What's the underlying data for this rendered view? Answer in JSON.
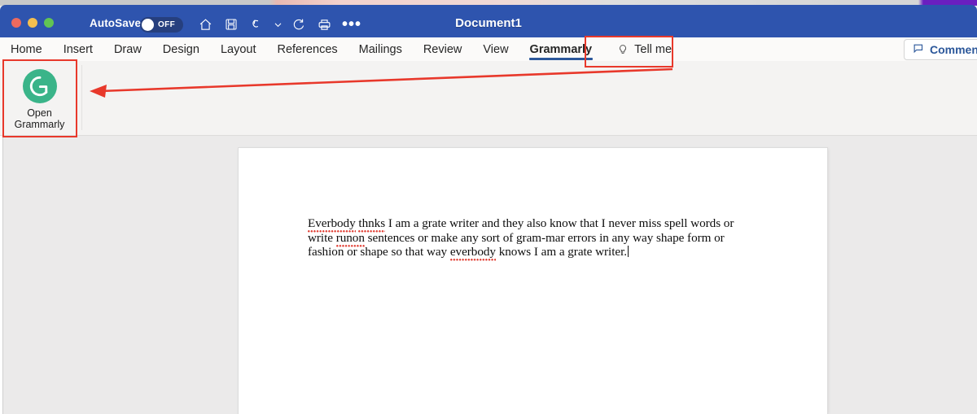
{
  "window": {
    "title": "Document1",
    "traffic_lights": [
      "close",
      "minimize",
      "maximize"
    ],
    "accent_blue": "#2e54ae",
    "annotation_red": "#e8382b"
  },
  "quick_access": {
    "autosave_label": "AutoSave",
    "autosave_state": "OFF",
    "icons": [
      {
        "name": "home-icon",
        "label": "Home"
      },
      {
        "name": "save-icon",
        "label": "Save"
      },
      {
        "name": "undo-icon",
        "label": "Undo"
      },
      {
        "name": "chevron-down-icon",
        "label": "More undo options"
      },
      {
        "name": "redo-icon",
        "label": "Redo"
      },
      {
        "name": "print-icon",
        "label": "Print"
      },
      {
        "name": "more-options-icon",
        "label": "…"
      }
    ]
  },
  "ribbon": {
    "tabs": [
      {
        "label": "Home",
        "active": false
      },
      {
        "label": "Insert",
        "active": false
      },
      {
        "label": "Draw",
        "active": false
      },
      {
        "label": "Design",
        "active": false
      },
      {
        "label": "Layout",
        "active": false
      },
      {
        "label": "References",
        "active": false
      },
      {
        "label": "Mailings",
        "active": false
      },
      {
        "label": "Review",
        "active": false
      },
      {
        "label": "View",
        "active": false
      },
      {
        "label": "Grammarly",
        "active": true
      }
    ],
    "tell_me": "Tell me",
    "comments_button": "Comments",
    "grammarly_group": {
      "button_line1": "Open",
      "button_line2": "Grammarly",
      "logo_name": "grammarly-logo",
      "logo_color": "#3ab489"
    }
  },
  "document": {
    "paragraph_segments": [
      {
        "text": "Everbody",
        "misspelled": true
      },
      {
        "text": " ",
        "misspelled": false
      },
      {
        "text": "thnks",
        "misspelled": true
      },
      {
        "text": " I am a grate writer and they also know that I never miss spell words or write ",
        "misspelled": false
      },
      {
        "text": "runon",
        "misspelled": true
      },
      {
        "text": " sentences or make any sort of gram-mar errors in any way shape form or fashion or shape so that way ",
        "misspelled": false
      },
      {
        "text": "everbody",
        "misspelled": true
      },
      {
        "text": " knows I am a grate writer.",
        "misspelled": false
      }
    ],
    "full_text": "Everbody thnks I am a grate writer and they also know that I never miss spell words or write runon sentences or make any sort of gram-mar errors in any way shape form or fashion or shape so that way everbody knows I am a grate writer.",
    "caret_visible": true
  },
  "annotations": {
    "box_open_grammarly": "highlight around Open Grammarly button",
    "box_grammarly_tab": "highlight around Grammarly ribbon tab",
    "arrow": "red arrow from Grammarly tab to Open Grammarly button"
  }
}
